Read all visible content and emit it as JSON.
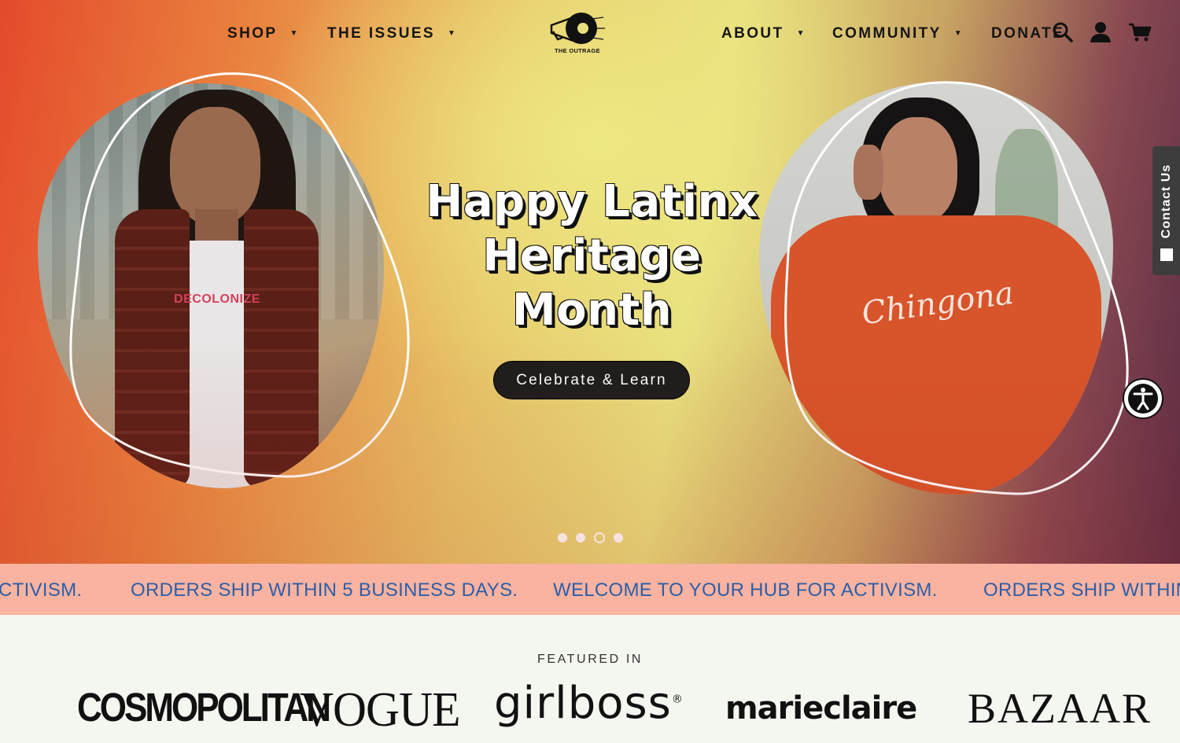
{
  "nav": {
    "left": [
      {
        "label": "SHOP"
      },
      {
        "label": "THE ISSUES"
      }
    ],
    "right": [
      {
        "label": "ABOUT"
      },
      {
        "label": "COMMUNITY"
      },
      {
        "label": "DONATE"
      }
    ],
    "logo_text": "THE OUTRAGE",
    "icons": [
      "search-icon",
      "account-icon",
      "cart-icon"
    ]
  },
  "hero": {
    "headline_line1": "Happy Latinx",
    "headline_line2": "Heritage",
    "headline_line3": "Month",
    "cta_label": "Celebrate & Learn",
    "left_shirt_text": "DECOLONIZE",
    "right_shirt_text": "Chingona",
    "slide_count": 4,
    "active_slide": 3
  },
  "contact_tab": {
    "label": "Contact Us"
  },
  "marquee": {
    "items": [
      "CTIVISM.",
      "ORDERS SHIP WITHIN 5 BUSINESS DAYS.",
      "WELCOME TO YOUR HUB FOR ACTIVISM.",
      "ORDERS SHIP WITHIN"
    ]
  },
  "featured": {
    "title": "FEATURED IN",
    "logos": [
      "COSMOPOLITAN",
      "VOGUE",
      "girlboss",
      "marieclaire",
      "BAZAAR"
    ],
    "girlboss_mark": "®"
  },
  "colors": {
    "marquee_bg": "#f9b3a0",
    "marquee_text": "#2c5ea8",
    "cta_bg": "#1d1d1d",
    "right_sweater": "#d8542a"
  }
}
